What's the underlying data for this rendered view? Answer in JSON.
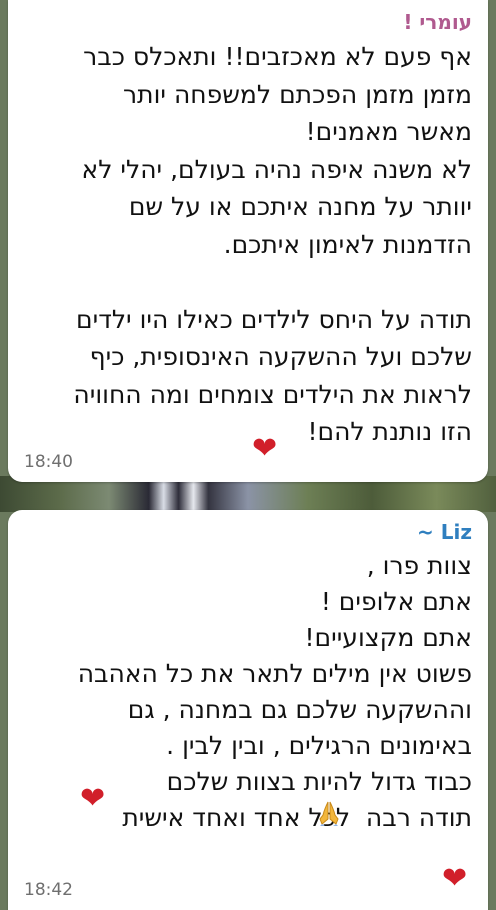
{
  "messages": [
    {
      "sender": "עומרי !",
      "text": "אף פעם לא מאכזבים!! ותאכלס כבר\nמזמן מזמן הפכתם למשפחה יותר\nמאשר מאמנים!\nלא משנה איפה נהיה בעולם, יהלי לא\nיוותר על מחנה איתכם או על שם\nהזדמנות לאימון איתכם.\n\nתודה על היחס לילדים כאילו היו ילדים\nשלכם ועל ההשקעה האינסופית, כיף\nלראות את הילדים צומחים ומה החוויה\nהזו נותנת להם!",
      "time": "18:40",
      "trailing_icons": [
        "heart-icon"
      ]
    },
    {
      "sender": "~ Liz",
      "text": "צוות פרו ,\nאתם אלופים !\nאתם מקצועיים!\nפשוט אין מילים לתאר את כל האהבה\nוההשקעה שלכם גם במחנה , גם\nבאימונים הרגילים , ובין לבין .\nכבוד גדול להיות בצוות שלכם\nתודה רבה  לכל אחד ואחד אישית",
      "time": "18:42",
      "trailing_icons": [
        "heart-icon",
        "praying-hands-icon",
        "heart-icon"
      ]
    }
  ],
  "colors": {
    "sender_1": "#b05a8f",
    "sender_2": "#2f7fbf",
    "heart": "#d11f2a"
  }
}
